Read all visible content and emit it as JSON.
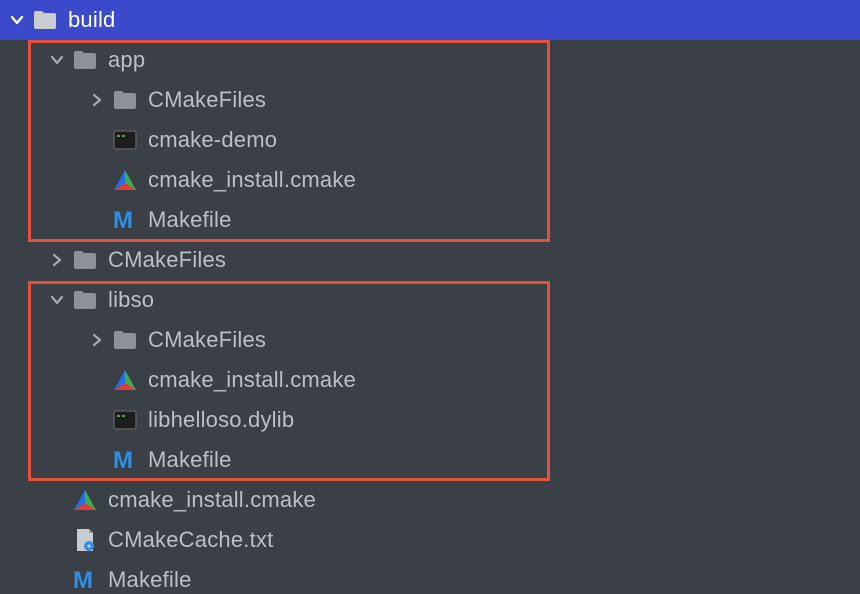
{
  "tree": {
    "root": {
      "label": "build"
    },
    "app": {
      "label": "app",
      "children": {
        "cmakefiles": "CMakeFiles",
        "cmake_demo": "cmake-demo",
        "cmake_install": "cmake_install.cmake",
        "makefile": "Makefile"
      }
    },
    "cmakefiles": "CMakeFiles",
    "libso": {
      "label": "libso",
      "children": {
        "cmakefiles": "CMakeFiles",
        "cmake_install": "cmake_install.cmake",
        "libhelloso": "libhelloso.dylib",
        "makefile": "Makefile"
      }
    },
    "cmake_install": "cmake_install.cmake",
    "cmakecache": "CMakeCache.txt",
    "makefile": "Makefile"
  },
  "colors": {
    "primaryHighlight": "#3A4ACB",
    "annotationBorder": "#E2513D",
    "background": "#3B4046",
    "text": "#BDBFC4"
  }
}
